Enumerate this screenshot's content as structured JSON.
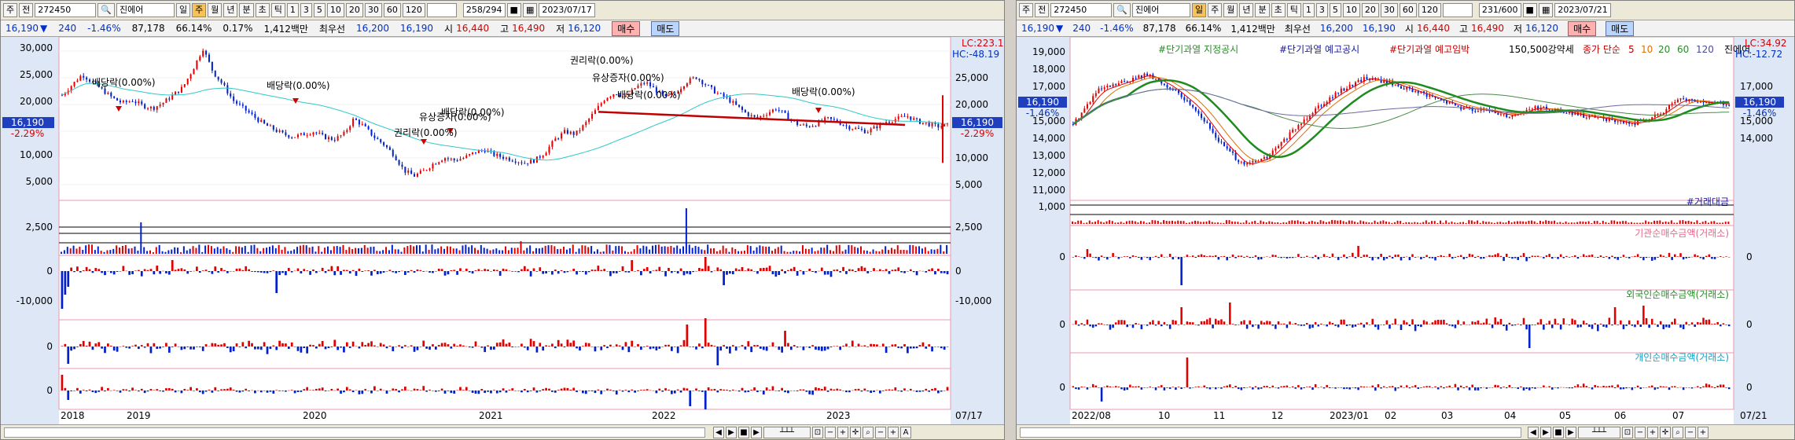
{
  "left": {
    "toolbar": {
      "market": "주",
      "prev": "전",
      "code": "272450",
      "name": "진에어",
      "periods": [
        "일",
        "주",
        "월",
        "년",
        "분",
        "초",
        "틱"
      ],
      "active_period": "주",
      "ns": [
        "1",
        "3",
        "5",
        "10",
        "20",
        "30",
        "60",
        "120"
      ],
      "count": "258",
      "total": "/294",
      "date": "2023/07/17"
    },
    "info": {
      "price": "16,190",
      "change": "240",
      "rate": "-1.46%",
      "volume": "87,178",
      "vol_ratio": "66.14%",
      "turnover": "0.17%",
      "amount": "1,412백만",
      "best_label": "최우선",
      "ask": "16,200",
      "bid": "16,190",
      "open_label": "시",
      "open": "16,440",
      "high_label": "고",
      "high": "16,490",
      "low_label": "저",
      "low": "16,120",
      "buy": "매수",
      "sell": "매도"
    },
    "lc": "LC:223.15",
    "hc": "HC:-48.19",
    "price_ticks": [
      "30,000",
      "25,000",
      "20,000",
      "15,000",
      "10,000",
      "5,000"
    ],
    "cur_price": "16,190",
    "cur_rate": "-2.29%",
    "vol_tick": "2,500",
    "net_ticks": [
      "0",
      "-10,000"
    ],
    "zero": "0",
    "x_labels": [
      "2018",
      "2019",
      "2020",
      "2021",
      "2022",
      "2023",
      "07/17"
    ],
    "annotations": [
      "배당락(0.00%)",
      "배당락(0.00%)",
      "권리락(0.00%)",
      "유상증자(0.00%)",
      "배당락(0.00%)",
      "권리락(0.00%)",
      "유상증자(0.00%)",
      "배당락(0.00%)",
      "배당락(0.00%)"
    ],
    "chart_data": {
      "type": "candlestick",
      "ylim": [
        3000,
        32000
      ],
      "x": [
        "2018",
        "2019",
        "2020",
        "2021",
        "2022",
        "2023",
        "07/17"
      ],
      "close_weekly": [
        22000,
        24000,
        26000,
        24500,
        23000,
        21500,
        20500,
        21000,
        20000,
        19500,
        20500,
        22000,
        23500,
        27000,
        31000,
        26500,
        24000,
        21000,
        19500,
        18000,
        16500,
        15500,
        14500,
        14000,
        14500,
        15000,
        14000,
        13500,
        14500,
        17500,
        16000,
        14000,
        12500,
        10500,
        7500,
        6500,
        7500,
        9000,
        10000,
        9500,
        10000,
        11000,
        11500,
        10500,
        10000,
        9500,
        9000,
        9500,
        11000,
        13500,
        15000,
        14500,
        16500,
        19000,
        21500,
        22500,
        21500,
        23500,
        24500,
        23000,
        21500,
        22500,
        24500,
        25500,
        24000,
        22500,
        21500,
        20000,
        18500,
        17500,
        18500,
        19500,
        18000,
        16500,
        16000,
        16500,
        17500,
        17000,
        16000,
        15500,
        15000,
        16000,
        17000,
        17500,
        18000,
        17000,
        16500,
        16000,
        16190
      ]
    }
  },
  "right": {
    "toolbar": {
      "market": "주",
      "prev": "전",
      "code": "272450",
      "name": "진에어",
      "periods": [
        "일",
        "주",
        "월",
        "년",
        "분",
        "초",
        "틱"
      ],
      "active_period": "일",
      "ns": [
        "1",
        "3",
        "5",
        "10",
        "20",
        "30",
        "60",
        "120"
      ],
      "count": "231",
      "total": "/600",
      "date": "2023/07/21"
    },
    "info": {
      "price": "16,190",
      "change": "240",
      "rate": "-1.46%",
      "volume": "87,178",
      "vol_ratio": "66.14%",
      "amount": "1,412백만",
      "best_label": "최우선",
      "ask": "16,200",
      "bid": "16,190",
      "open_label": "시",
      "open": "16,440",
      "high_label": "고",
      "high": "16,490",
      "low_label": "저",
      "low": "16,120",
      "buy": "매수",
      "sell": "매도"
    },
    "legend": [
      "#단기과열 지정공시",
      "#단기과열 예고공시",
      "#단기과열 예고임박",
      "150,500강약세",
      "종가 단순",
      "5",
      "10",
      "20",
      "60",
      "120",
      "진에어"
    ],
    "lc": "LC:34.92",
    "hc": "HC:-12.72",
    "price_ticks": [
      "19,000",
      "18,000",
      "17,000",
      "16,000",
      "15,000",
      "14,000",
      "13,000",
      "12,000",
      "11,000"
    ],
    "right_ticks": [
      "17,000",
      "16,000",
      "15,000",
      "14,000"
    ],
    "cur_price": "16,190",
    "cur_rate": "-1.46%",
    "vol_tick": "1,000",
    "vol_label": "#거래대금",
    "panel_labels": [
      "기관순매수금액(거래소)",
      "외국인순매수금액(거래소)",
      "개인순매수금액(거래소)"
    ],
    "zero": "0",
    "x_labels": [
      "2022/08",
      "10",
      "11",
      "12",
      "2023/01",
      "02",
      "03",
      "04",
      "05",
      "06",
      "07",
      "07/21"
    ],
    "chart_data": {
      "type": "candlestick",
      "ylim": [
        10500,
        19500
      ],
      "x": [
        "2022/08",
        "10",
        "11",
        "12",
        "2023/01",
        "02",
        "03",
        "04",
        "05",
        "06",
        "07",
        "07/21"
      ],
      "close_monthly": [
        15000,
        17000,
        17500,
        18000,
        17200,
        16000,
        14000,
        12500,
        13000,
        14500,
        16000,
        17000,
        17800,
        17500,
        17000,
        16500,
        16000,
        15800,
        15500,
        16000,
        15800,
        15500,
        15300,
        15000,
        15500,
        16500,
        16300,
        16190
      ]
    }
  }
}
